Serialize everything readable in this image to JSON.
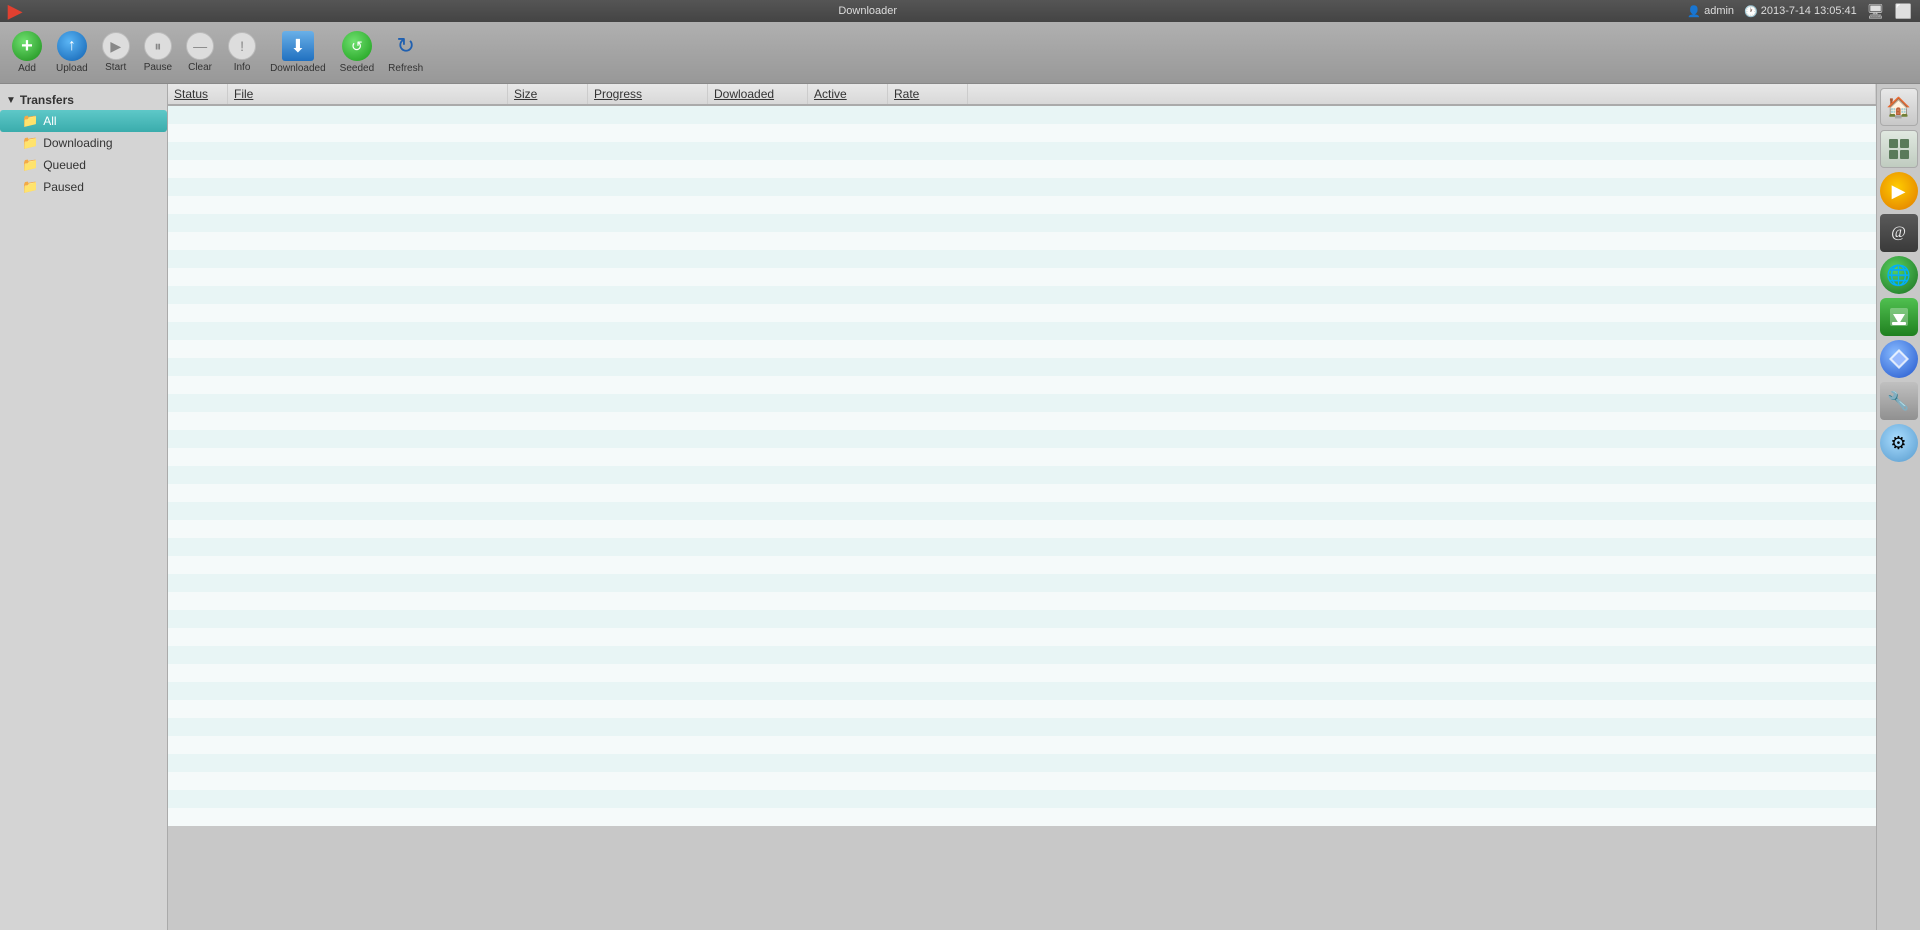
{
  "topbar": {
    "title": "Downloader",
    "user": "admin",
    "datetime": "2013-7-14 13:05:41"
  },
  "toolbar": {
    "add_label": "Add",
    "upload_label": "Upload",
    "start_label": "Start",
    "pause_label": "Pause",
    "clear_label": "Clear",
    "info_label": "Info",
    "downloaded_label": "Downloaded",
    "seeded_label": "Seeded",
    "refresh_label": "Refresh"
  },
  "sidebar": {
    "section_label": "Transfers",
    "items": [
      {
        "label": "All",
        "active": true
      },
      {
        "label": "Downloading",
        "active": false
      },
      {
        "label": "Queued",
        "active": false
      },
      {
        "label": "Paused",
        "active": false
      }
    ]
  },
  "table": {
    "columns": [
      {
        "label": "Status",
        "key": "status"
      },
      {
        "label": "File",
        "key": "file"
      },
      {
        "label": "Size",
        "key": "size"
      },
      {
        "label": "Progress",
        "key": "progress"
      },
      {
        "label": "Dowloaded",
        "key": "downloaded"
      },
      {
        "label": "Active",
        "key": "active"
      },
      {
        "label": "Rate",
        "key": "rate"
      }
    ],
    "rows": []
  },
  "dock": {
    "icons": [
      {
        "name": "home",
        "symbol": "🏠"
      },
      {
        "name": "grid",
        "symbol": "⊞"
      },
      {
        "name": "play",
        "symbol": "▶"
      },
      {
        "name": "email",
        "symbol": "@"
      },
      {
        "name": "globe",
        "symbol": "🌐"
      },
      {
        "name": "downloader-app",
        "symbol": "↓"
      },
      {
        "name": "diamond",
        "symbol": "◆"
      },
      {
        "name": "tools",
        "symbol": "🔧"
      },
      {
        "name": "settings",
        "symbol": "⚙"
      }
    ]
  },
  "row_count": 40
}
